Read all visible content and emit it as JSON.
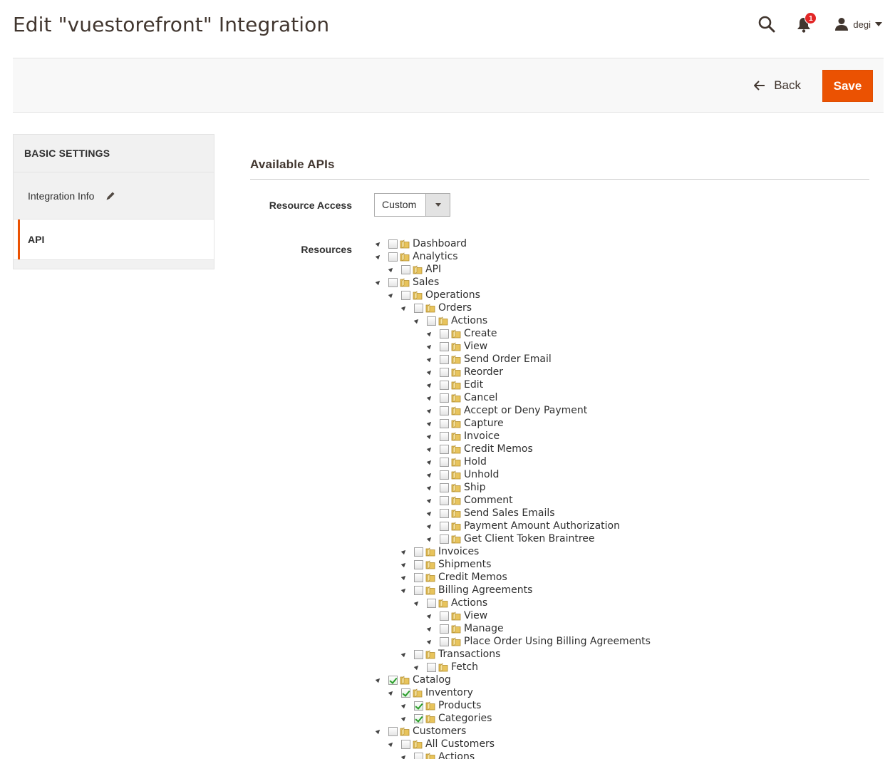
{
  "header": {
    "title": "Edit \"vuestorefront\" Integration",
    "notifications_count": "1",
    "user_name": "degi"
  },
  "actions": {
    "back_label": "Back",
    "save_label": "Save"
  },
  "sidebar": {
    "title": "BASIC SETTINGS",
    "items": [
      {
        "label": "Integration Info",
        "active": false
      },
      {
        "label": "API",
        "active": true
      }
    ]
  },
  "main": {
    "section_title": "Available APIs",
    "resource_access_label": "Resource Access",
    "resource_access_value": "Custom",
    "resources_label": "Resources"
  },
  "colors": {
    "accent": "#eb5202",
    "badge": "#e22626",
    "check": "#2a9d2a"
  },
  "tree": [
    {
      "label": "Dashboard",
      "depth": 0,
      "checked": false
    },
    {
      "label": "Analytics",
      "depth": 0,
      "checked": false
    },
    {
      "label": "API",
      "depth": 1,
      "checked": false
    },
    {
      "label": "Sales",
      "depth": 0,
      "checked": false
    },
    {
      "label": "Operations",
      "depth": 1,
      "checked": false
    },
    {
      "label": "Orders",
      "depth": 2,
      "checked": false
    },
    {
      "label": "Actions",
      "depth": 3,
      "checked": false
    },
    {
      "label": "Create",
      "depth": 4,
      "checked": false
    },
    {
      "label": "View",
      "depth": 4,
      "checked": false
    },
    {
      "label": "Send Order Email",
      "depth": 4,
      "checked": false
    },
    {
      "label": "Reorder",
      "depth": 4,
      "checked": false
    },
    {
      "label": "Edit",
      "depth": 4,
      "checked": false
    },
    {
      "label": "Cancel",
      "depth": 4,
      "checked": false
    },
    {
      "label": "Accept or Deny Payment",
      "depth": 4,
      "checked": false
    },
    {
      "label": "Capture",
      "depth": 4,
      "checked": false
    },
    {
      "label": "Invoice",
      "depth": 4,
      "checked": false
    },
    {
      "label": "Credit Memos",
      "depth": 4,
      "checked": false
    },
    {
      "label": "Hold",
      "depth": 4,
      "checked": false
    },
    {
      "label": "Unhold",
      "depth": 4,
      "checked": false
    },
    {
      "label": "Ship",
      "depth": 4,
      "checked": false
    },
    {
      "label": "Comment",
      "depth": 4,
      "checked": false
    },
    {
      "label": "Send Sales Emails",
      "depth": 4,
      "checked": false
    },
    {
      "label": "Payment Amount Authorization",
      "depth": 4,
      "checked": false
    },
    {
      "label": "Get Client Token Braintree",
      "depth": 4,
      "checked": false
    },
    {
      "label": "Invoices",
      "depth": 2,
      "checked": false
    },
    {
      "label": "Shipments",
      "depth": 2,
      "checked": false
    },
    {
      "label": "Credit Memos",
      "depth": 2,
      "checked": false
    },
    {
      "label": "Billing Agreements",
      "depth": 2,
      "checked": false
    },
    {
      "label": "Actions",
      "depth": 3,
      "checked": false
    },
    {
      "label": "View",
      "depth": 4,
      "checked": false
    },
    {
      "label": "Manage",
      "depth": 4,
      "checked": false
    },
    {
      "label": "Place Order Using Billing Agreements",
      "depth": 4,
      "checked": false
    },
    {
      "label": "Transactions",
      "depth": 2,
      "checked": false
    },
    {
      "label": "Fetch",
      "depth": 3,
      "checked": false
    },
    {
      "label": "Catalog",
      "depth": 0,
      "checked": true
    },
    {
      "label": "Inventory",
      "depth": 1,
      "checked": true
    },
    {
      "label": "Products",
      "depth": 2,
      "checked": true
    },
    {
      "label": "Categories",
      "depth": 2,
      "checked": true
    },
    {
      "label": "Customers",
      "depth": 0,
      "checked": false
    },
    {
      "label": "All Customers",
      "depth": 1,
      "checked": false
    },
    {
      "label": "Actions",
      "depth": 2,
      "checked": false
    }
  ]
}
